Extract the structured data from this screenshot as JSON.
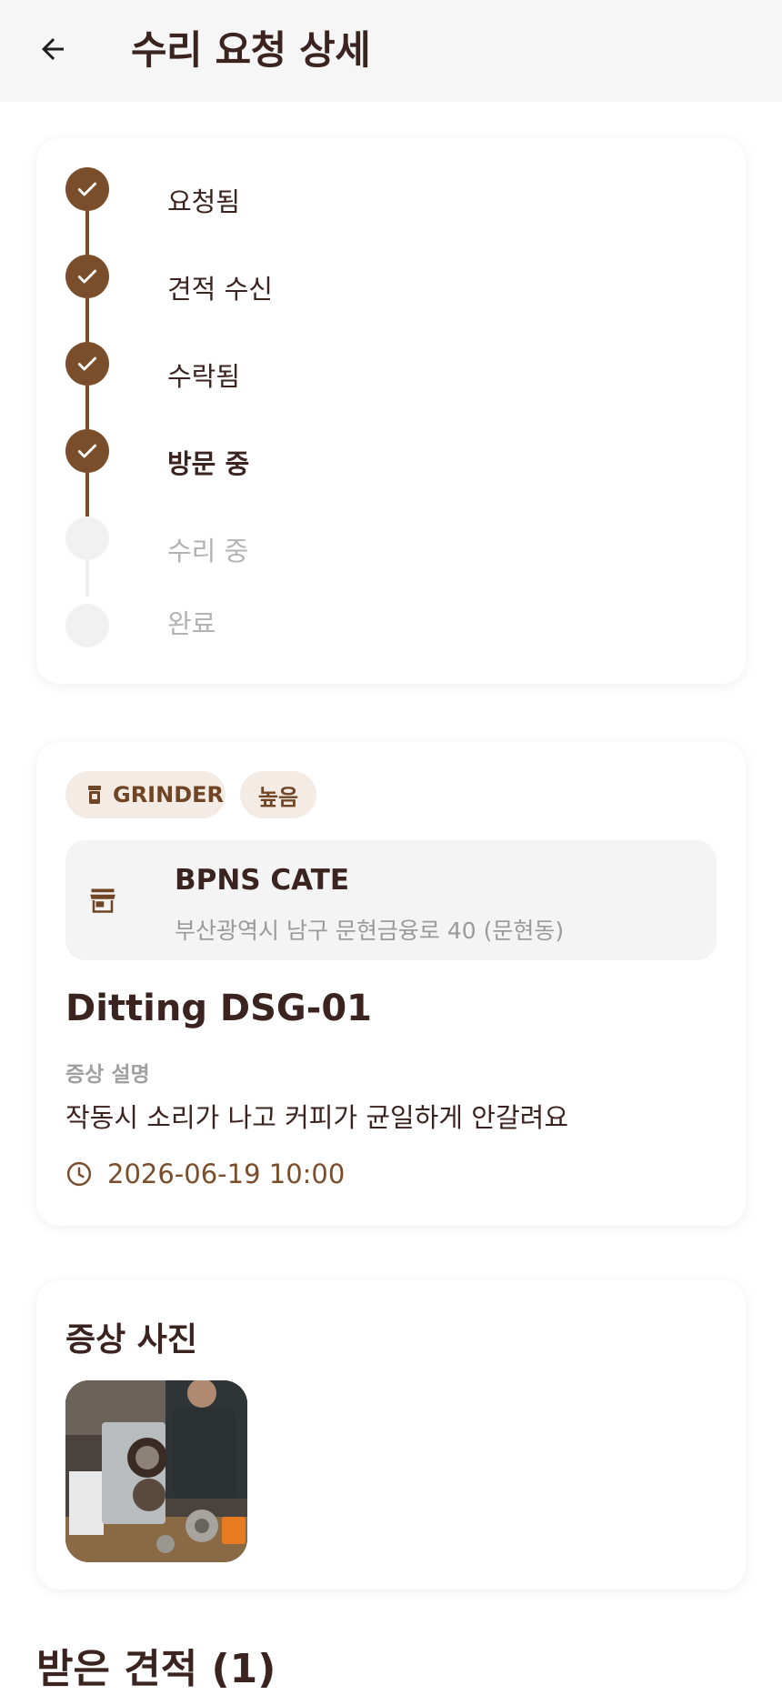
{
  "header": {
    "title": "수리 요청 상세",
    "back_icon": "arrow-left-icon"
  },
  "progress": {
    "steps": [
      {
        "label": "요청됨",
        "status": "done"
      },
      {
        "label": "견적 수신",
        "status": "done"
      },
      {
        "label": "수락됨",
        "status": "done"
      },
      {
        "label": "방문 중",
        "status": "current"
      },
      {
        "label": "수리 중",
        "status": "pending"
      },
      {
        "label": "완료",
        "status": "pending"
      }
    ]
  },
  "request": {
    "type_chip": "GRINDER",
    "priority_chip": "높음",
    "shop_name": "BPNS CATE",
    "shop_address": "부산광역시 남구 문현금융로 40 (문현동)",
    "equipment": "Ditting DSG-01",
    "symptom_label": "증상 설명",
    "symptom_text": "작동시 소리가 나고 커피가 균일하게 안갈려요",
    "schedule": "2026-06-19 10:00"
  },
  "photos": {
    "title": "증상 사진"
  },
  "quotes": {
    "title": "받은 견적 (1)"
  },
  "colors": {
    "accent": "#7a4e2b",
    "text": "#3b2320",
    "chip_bg": "#f4ece4",
    "muted": "#9a9a9a",
    "pending": "#f1f1f1"
  }
}
